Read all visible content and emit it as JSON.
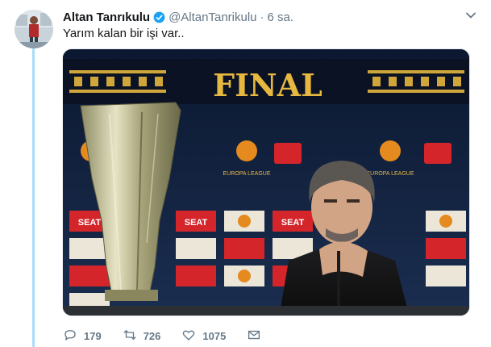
{
  "tweet": {
    "author_name": "Altan Tanrıkulu",
    "handle": "@AltanTanrikulu",
    "separator": "·",
    "time": "6 sa.",
    "text": "Yarım kalan bir işi var..",
    "icons": [
      "verified-badge-icon",
      "chevron-down-icon",
      "reply-icon",
      "retweet-icon",
      "like-icon",
      "message-icon"
    ],
    "colors": {
      "accent": "#1da1f2",
      "thread_line": "#a9dcf5",
      "muted": "#657786"
    }
  },
  "media": {
    "banner_text": "FINAL",
    "sponsor_text": "SEAT",
    "logo_text": "EUROPA LEAGUE"
  },
  "actions": {
    "replies": "179",
    "retweets": "726",
    "likes": "1075"
  }
}
